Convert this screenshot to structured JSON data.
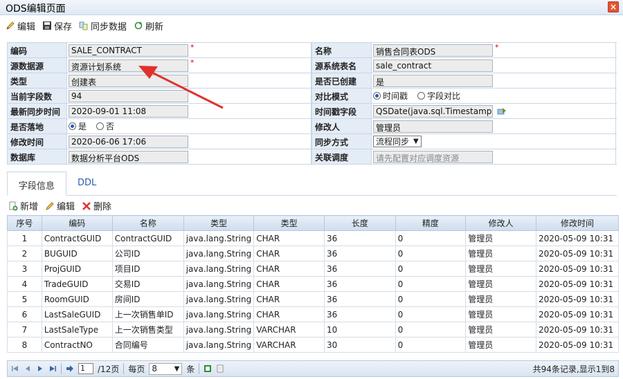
{
  "window": {
    "title": "ODS编辑页面",
    "close": "×"
  },
  "toolbar": {
    "edit": "编辑",
    "save": "保存",
    "sync": "同步数据",
    "refresh": "刷新"
  },
  "form": {
    "labels": {
      "code": "编码",
      "name": "名称",
      "datasource": "源数据源",
      "src_table": "源系统表名",
      "type": "类型",
      "created": "是否已创建",
      "field_count": "当前字段数",
      "compare_mode": "对比模式",
      "last_sync": "最新同步时间",
      "timestamp_field": "时间戳字段",
      "landing": "是否落地",
      "modifier": "修改人",
      "modify_time": "修改时间",
      "sync_mode": "同步方式",
      "database": "数据库",
      "schedule": "关联调度"
    },
    "values": {
      "code": "SALE_CONTRACT",
      "name": "销售合同表ODS",
      "datasource": "资源计划系统",
      "src_table": "sale_contract",
      "type": "创建表",
      "created": "是",
      "field_count": "94",
      "last_sync": "2020-09-01 11:08",
      "timestamp_field": "QSDate(java.sql.Timestamp)",
      "modifier": "管理员",
      "modify_time": "2020-06-06 17:06",
      "sync_mode": "流程同步",
      "database": "数据分析平台ODS",
      "schedule_placeholder": "请先配置对应调度资源"
    },
    "compare_options": {
      "a": "时间戳",
      "b": "字段对比"
    },
    "landing_options": {
      "yes": "是",
      "no": "否"
    },
    "required": "*"
  },
  "tabs": {
    "fields": "字段信息",
    "ddl": "DDL"
  },
  "grid_toolbar": {
    "add": "新增",
    "edit": "编辑",
    "delete": "删除"
  },
  "table": {
    "headers": [
      "序号",
      "编码",
      "名称",
      "类型",
      "类型",
      "长度",
      "精度",
      "修改人",
      "修改时间"
    ],
    "rows": [
      [
        "1",
        "ContractGUID",
        "ContractGUID",
        "java.lang.String",
        "CHAR",
        "36",
        "0",
        "管理员",
        "2020-05-09 10:31"
      ],
      [
        "2",
        "BUGUID",
        "公司ID",
        "java.lang.String",
        "CHAR",
        "36",
        "0",
        "管理员",
        "2020-05-09 10:31"
      ],
      [
        "3",
        "ProjGUID",
        "项目ID",
        "java.lang.String",
        "CHAR",
        "36",
        "0",
        "管理员",
        "2020-05-09 10:31"
      ],
      [
        "4",
        "TradeGUID",
        "交易ID",
        "java.lang.String",
        "CHAR",
        "36",
        "0",
        "管理员",
        "2020-05-09 10:31"
      ],
      [
        "5",
        "RoomGUID",
        "房间ID",
        "java.lang.String",
        "CHAR",
        "36",
        "0",
        "管理员",
        "2020-05-09 10:31"
      ],
      [
        "6",
        "LastSaleGUID",
        "上一次销售单ID",
        "java.lang.String",
        "CHAR",
        "36",
        "0",
        "管理员",
        "2020-05-09 10:31"
      ],
      [
        "7",
        "LastSaleType",
        "上一次销售类型",
        "java.lang.String",
        "VARCHAR",
        "10",
        "0",
        "管理员",
        "2020-05-09 10:31"
      ],
      [
        "8",
        "ContractNO",
        "合同编号",
        "java.lang.String",
        "VARCHAR",
        "30",
        "0",
        "管理员",
        "2020-05-09 10:31"
      ]
    ]
  },
  "pager": {
    "page": "1",
    "total_pages": "/12页",
    "per_page_label": "每页",
    "per_page": "8",
    "unit": "条",
    "info": "共94条记录,显示1到8"
  },
  "colors": {
    "accent": "#1d57c9",
    "arrow": "#e0312b",
    "header_bg": "#e4ecf6"
  }
}
